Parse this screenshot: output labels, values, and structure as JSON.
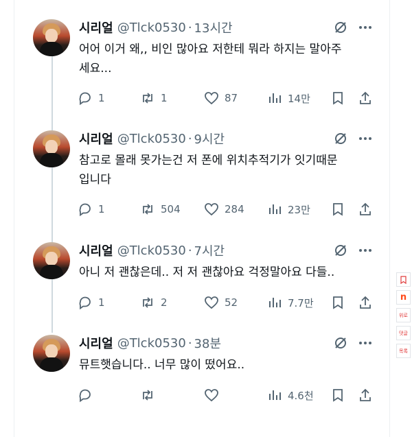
{
  "author": {
    "name": "시리얼",
    "handle": "@Tlck0530"
  },
  "tweets": [
    {
      "time": "13시간",
      "lines": [
        "어어 이거 왜,, 비인 많아요 저한테 뭐라 하지는 말아주",
        "세요..."
      ],
      "replies": "1",
      "retweets": "1",
      "likes": "87",
      "views": "14만"
    },
    {
      "time": "9시간",
      "lines": [
        "참고로 몰래 못가는건 저 폰에 위치추적기가 잇기때문",
        "입니다"
      ],
      "replies": "1",
      "retweets": "504",
      "likes": "284",
      "views": "23만"
    },
    {
      "time": "7시간",
      "lines": [
        "아니 저 괜찮은데.. 저 저 괜찮아요 걱정말아요 다들.."
      ],
      "replies": "1",
      "retweets": "2",
      "likes": "52",
      "views": "7.7만"
    },
    {
      "time": "38분",
      "lines": [
        "뮤트햇습니다.. 너무 많이 떴어요.."
      ],
      "replies": "",
      "retweets": "",
      "likes": "",
      "views": "4.6천"
    }
  ],
  "side_widget": {
    "labels": [
      "n",
      "위로",
      "댓글",
      "목록"
    ]
  },
  "colors": {
    "text": "#0f1419",
    "muted": "#536471",
    "thread_line": "#cfd9de"
  }
}
